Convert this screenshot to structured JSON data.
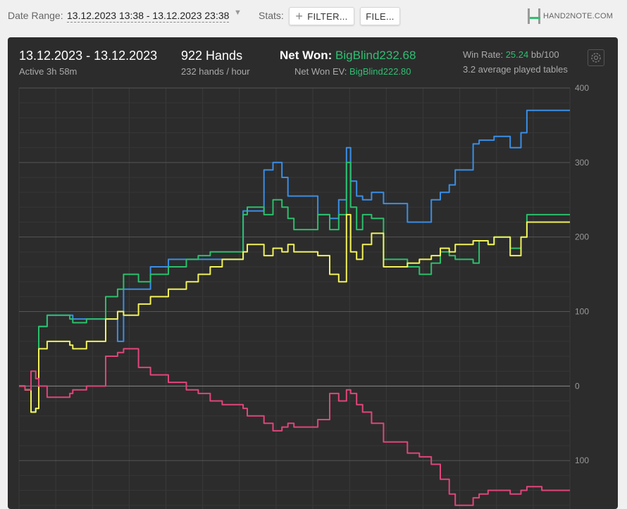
{
  "topbar": {
    "date_label": "Date Range:",
    "date_value": "13.12.2023 13:38 - 13.12.2023 23:38",
    "stats_label": "Stats:",
    "filter_label": "FILTER...",
    "file_label": "FILE...",
    "logo_text": "HAND2NOTE.COM"
  },
  "summary": {
    "period": "13.12.2023 - 13.12.2023",
    "active": "Active 3h 58m",
    "hands": "922 Hands",
    "hands_per_hour": "232 hands / hour",
    "net_won_label": "Net Won:",
    "net_won_value": "BigBlind232.68",
    "net_won_ev_label": "Net Won  EV:",
    "net_won_ev_value": "BigBlind222.80",
    "win_rate_label": "Win Rate:",
    "win_rate_value": "25.24",
    "win_rate_unit": "bb/100",
    "avg_tables": "3.2 average played tables"
  },
  "colors": {
    "blue": "#3a8ee6",
    "green": "#2bbf6b",
    "yellow": "#f2f25a",
    "pink": "#e0457b",
    "accent": "#2fbf72"
  },
  "chart_data": {
    "type": "line",
    "ylim": [
      -165,
      400
    ],
    "y_ticks": [
      400,
      300,
      200,
      100,
      0
    ],
    "y_tick_labels": [
      "400",
      "300",
      "200",
      "100",
      "0",
      "100"
    ],
    "x_range": [
      0,
      922
    ],
    "grid": true,
    "series": [
      {
        "color_key": "blue",
        "x": [
          0,
          10,
          20,
          28,
          33,
          47,
          85,
          90,
          113,
          145,
          165,
          175,
          200,
          220,
          250,
          375,
          382,
          410,
          425,
          440,
          450,
          500,
          520,
          535,
          548,
          555,
          565,
          575,
          590,
          610,
          650,
          670,
          690,
          705,
          720,
          730,
          760,
          770,
          785,
          795,
          822,
          840,
          850,
          875,
          890,
          905,
          922
        ],
        "y": [
          0,
          -5,
          -35,
          -30,
          80,
          95,
          95,
          90,
          90,
          90,
          60,
          130,
          130,
          160,
          170,
          235,
          235,
          290,
          300,
          280,
          255,
          230,
          225,
          250,
          320,
          275,
          255,
          250,
          260,
          245,
          220,
          220,
          250,
          260,
          270,
          290,
          325,
          330,
          330,
          335,
          320,
          340,
          370,
          370,
          370,
          370,
          370
        ]
      },
      {
        "color_key": "green",
        "x": [
          0,
          10,
          20,
          28,
          33,
          47,
          85,
          90,
          113,
          145,
          165,
          175,
          200,
          220,
          250,
          280,
          300,
          320,
          340,
          375,
          382,
          410,
          425,
          440,
          450,
          460,
          500,
          520,
          535,
          548,
          555,
          565,
          575,
          590,
          610,
          650,
          670,
          690,
          705,
          720,
          730,
          760,
          770,
          785,
          795,
          822,
          840,
          850,
          875,
          890,
          905,
          922
        ],
        "y": [
          0,
          -5,
          -35,
          -30,
          80,
          95,
          90,
          85,
          90,
          120,
          130,
          150,
          140,
          150,
          160,
          170,
          175,
          180,
          180,
          230,
          240,
          230,
          250,
          240,
          225,
          210,
          230,
          210,
          230,
          300,
          240,
          210,
          230,
          225,
          170,
          160,
          150,
          165,
          180,
          175,
          170,
          165,
          195,
          190,
          200,
          185,
          200,
          230,
          230,
          230,
          230,
          230
        ]
      },
      {
        "color_key": "yellow",
        "x": [
          0,
          10,
          20,
          28,
          33,
          47,
          85,
          90,
          113,
          145,
          165,
          175,
          200,
          220,
          250,
          280,
          300,
          320,
          340,
          375,
          382,
          410,
          425,
          440,
          450,
          460,
          500,
          520,
          535,
          548,
          555,
          565,
          575,
          590,
          610,
          650,
          670,
          690,
          705,
          720,
          730,
          760,
          770,
          785,
          795,
          822,
          840,
          850,
          875,
          890,
          905,
          922
        ],
        "y": [
          0,
          -5,
          -35,
          -30,
          50,
          60,
          55,
          50,
          60,
          90,
          100,
          95,
          110,
          120,
          130,
          140,
          150,
          160,
          170,
          180,
          190,
          175,
          185,
          180,
          190,
          180,
          175,
          150,
          140,
          230,
          180,
          170,
          190,
          205,
          160,
          165,
          170,
          175,
          185,
          180,
          190,
          195,
          195,
          190,
          200,
          175,
          200,
          220,
          220,
          220,
          220,
          220
        ]
      },
      {
        "color_key": "pink",
        "x": [
          0,
          10,
          20,
          28,
          33,
          47,
          85,
          90,
          113,
          145,
          165,
          175,
          200,
          220,
          250,
          280,
          300,
          320,
          340,
          375,
          382,
          410,
          425,
          440,
          450,
          460,
          500,
          520,
          535,
          548,
          555,
          565,
          575,
          590,
          610,
          650,
          670,
          690,
          705,
          720,
          730,
          760,
          770,
          785,
          795,
          822,
          840,
          850,
          875,
          890,
          905,
          922
        ],
        "y": [
          0,
          -5,
          20,
          10,
          0,
          -15,
          -10,
          -5,
          0,
          40,
          45,
          50,
          25,
          15,
          5,
          -5,
          -10,
          -20,
          -25,
          -30,
          -40,
          -50,
          -60,
          -55,
          -50,
          -55,
          -45,
          -10,
          -20,
          -5,
          -10,
          -25,
          -35,
          -50,
          -75,
          -90,
          -95,
          -105,
          -125,
          -145,
          -160,
          -150,
          -145,
          -140,
          -140,
          -145,
          -140,
          -135,
          -140,
          -140,
          -140,
          -140
        ]
      }
    ]
  }
}
